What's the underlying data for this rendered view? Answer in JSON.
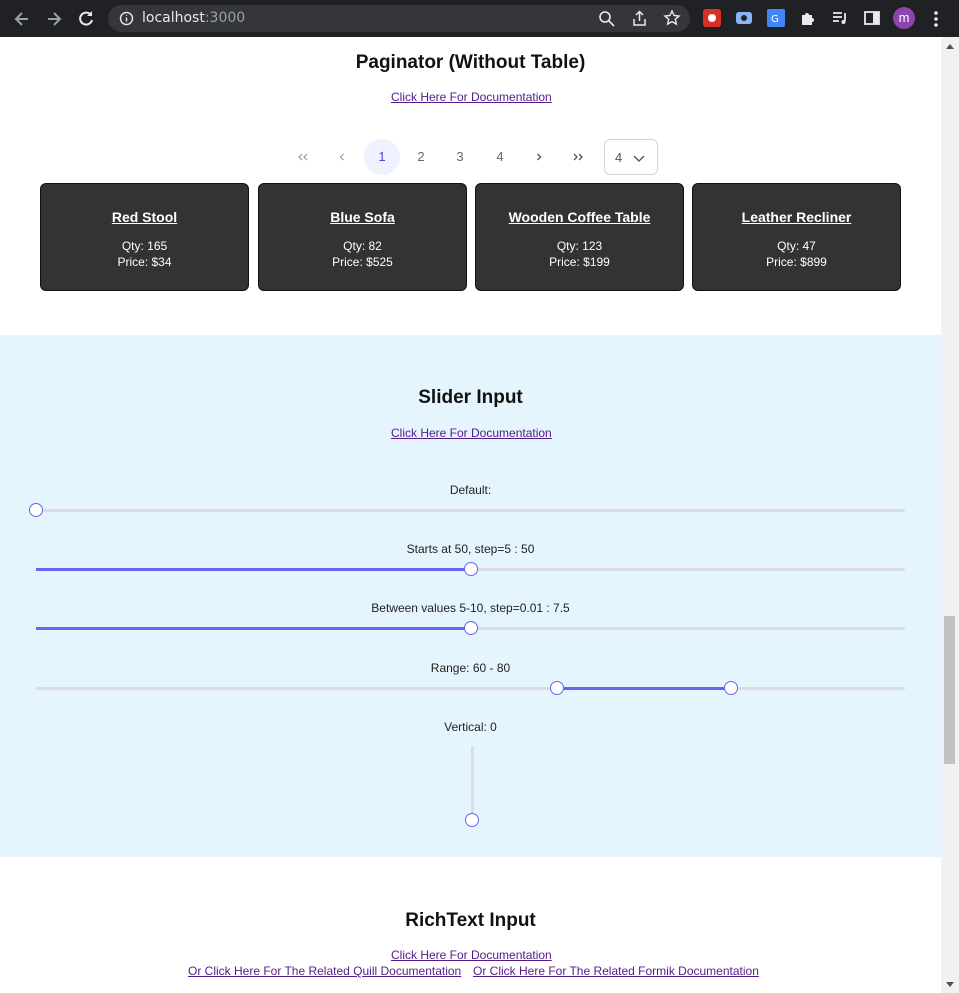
{
  "browser": {
    "url_host": "localhost",
    "url_port": ":3000",
    "profile_initial": "m"
  },
  "paginator": {
    "title": "Paginator (Without Table)",
    "doc_link": "Click Here For Documentation",
    "pages": [
      "1",
      "2",
      "3",
      "4"
    ],
    "active_page": "1",
    "first_label": "«",
    "prev_label": "‹",
    "next_label": "›",
    "last_label": "»",
    "rows_per_page": "4",
    "cards": [
      {
        "name": "Red Stool",
        "qty": "Qty: 165",
        "price": "Price: $34"
      },
      {
        "name": "Blue Sofa",
        "qty": "Qty: 82",
        "price": "Price: $525"
      },
      {
        "name": "Wooden Coffee Table",
        "qty": "Qty: 123",
        "price": "Price: $199"
      },
      {
        "name": "Leather Recliner",
        "qty": "Qty: 47",
        "price": "Price: $899"
      }
    ]
  },
  "slider": {
    "title": "Slider Input",
    "doc_link": "Click Here For Documentation",
    "default_label": "Default:",
    "step5_label": "Starts at 50, step=5 : 50",
    "between_label": "Between values 5-10, step=0.01 : 7.5",
    "range_label": "Range: 60 - 80",
    "vertical_label": "Vertical: 0",
    "values": {
      "default": 0,
      "step5": 50,
      "between": 0.5,
      "range_low": 60,
      "range_high": 80,
      "vertical": 0
    }
  },
  "richtext": {
    "title": "RichText Input",
    "doc_link": "Click Here For Documentation",
    "quill_link": "Or Click Here For The Related Quill Documentation",
    "formik_link": "Or Click Here For The Related Formik Documentation"
  },
  "colors": {
    "accent": "#6366f1",
    "card_bg": "#333333",
    "slider_bg": "#e5f5fd"
  }
}
